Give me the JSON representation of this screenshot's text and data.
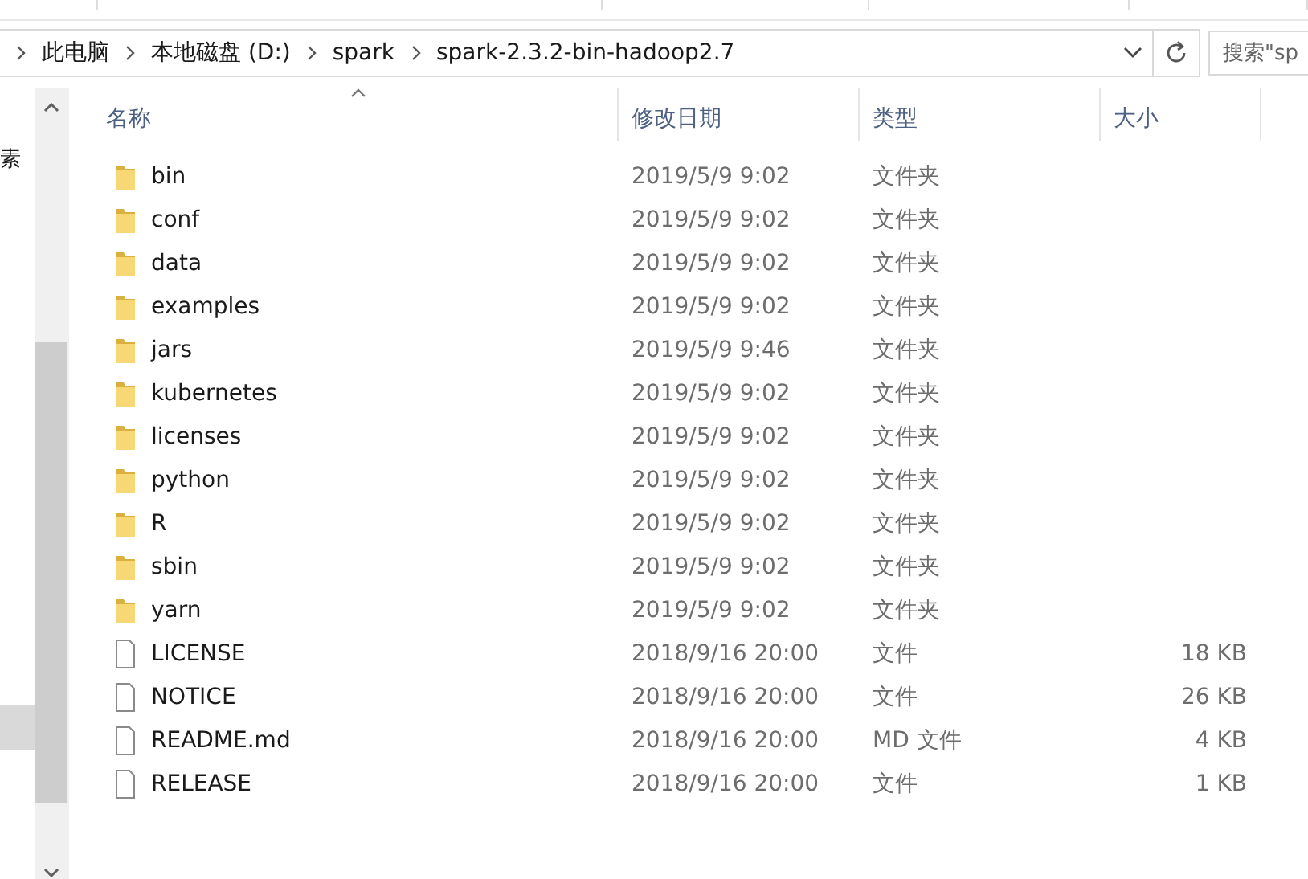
{
  "address_bar": {
    "crumbs": [
      "此电脑",
      "本地磁盘 (D:)",
      "spark",
      "spark-2.3.2-bin-hadoop2.7"
    ]
  },
  "search": {
    "placeholder": "搜索\"sp"
  },
  "nav_pane": {
    "items": [
      {
        "label": "素",
        "selected": false
      },
      {
        "selected": true
      }
    ]
  },
  "table": {
    "columns": [
      "名称",
      "修改日期",
      "类型",
      "大小"
    ],
    "rows": [
      {
        "kind": "folder",
        "name": "bin",
        "date": "2019/5/9 9:02",
        "type": "文件夹"
      },
      {
        "kind": "folder",
        "name": "conf",
        "date": "2019/5/9 9:02",
        "type": "文件夹"
      },
      {
        "kind": "folder",
        "name": "data",
        "date": "2019/5/9 9:02",
        "type": "文件夹"
      },
      {
        "kind": "folder",
        "name": "examples",
        "date": "2019/5/9 9:02",
        "type": "文件夹"
      },
      {
        "kind": "folder",
        "name": "jars",
        "date": "2019/5/9 9:46",
        "type": "文件夹"
      },
      {
        "kind": "folder",
        "name": "kubernetes",
        "date": "2019/5/9 9:02",
        "type": "文件夹"
      },
      {
        "kind": "folder",
        "name": "licenses",
        "date": "2019/5/9 9:02",
        "type": "文件夹"
      },
      {
        "kind": "folder",
        "name": "python",
        "date": "2019/5/9 9:02",
        "type": "文件夹"
      },
      {
        "kind": "folder",
        "name": "R",
        "date": "2019/5/9 9:02",
        "type": "文件夹"
      },
      {
        "kind": "folder",
        "name": "sbin",
        "date": "2019/5/9 9:02",
        "type": "文件夹"
      },
      {
        "kind": "folder",
        "name": "yarn",
        "date": "2019/5/9 9:02",
        "type": "文件夹"
      },
      {
        "kind": "file",
        "name": "LICENSE",
        "date": "2018/9/16 20:00",
        "type": "文件",
        "size": "18 KB"
      },
      {
        "kind": "file",
        "name": "NOTICE",
        "date": "2018/9/16 20:00",
        "type": "文件",
        "size": "26 KB"
      },
      {
        "kind": "file",
        "name": "README.md",
        "date": "2018/9/16 20:00",
        "type": "MD 文件",
        "size": "4 KB"
      },
      {
        "kind": "file",
        "name": "RELEASE",
        "date": "2018/9/16 20:00",
        "type": "文件",
        "size": "1 KB"
      }
    ]
  }
}
